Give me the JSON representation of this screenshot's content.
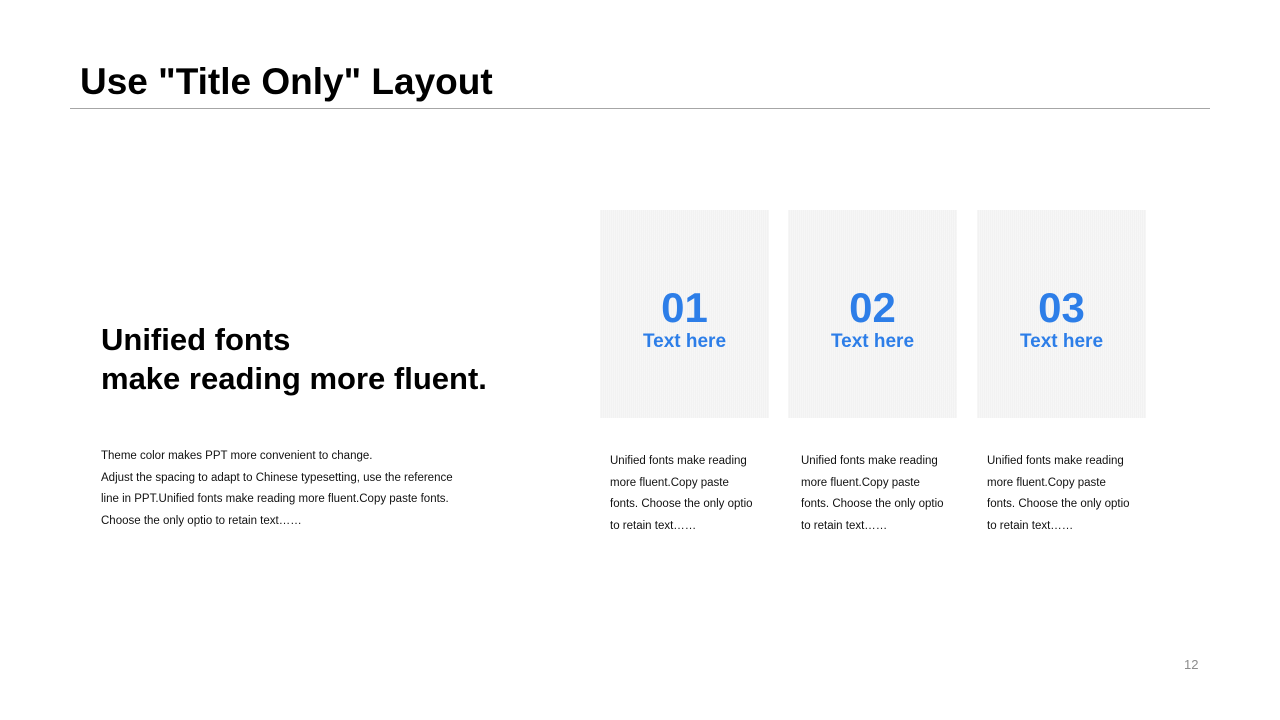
{
  "title": "Use \"Title Only\" Layout",
  "headline": {
    "line1": "Unified fonts",
    "line2": "make reading more fluent."
  },
  "body": {
    "lines": [
      "Theme  color makes PPT more convenient to change.",
      "Adjust the spacing to adapt to Chinese typesetting, use the reference",
      "line in PPT.Unified fonts make reading more fluent.Copy paste fonts.",
      "Choose the only optio to retain text……"
    ]
  },
  "accent_color": "#2d7ee8",
  "cards": [
    {
      "number": "01",
      "label": "Text here",
      "desc": [
        "Unified fonts make reading",
        "more fluent.Copy paste",
        "fonts. Choose the only optio",
        "to retain text……"
      ]
    },
    {
      "number": "02",
      "label": "Text here",
      "desc": [
        "Unified fonts make reading",
        "more fluent.Copy paste",
        "fonts. Choose the only optio",
        "to retain text……"
      ]
    },
    {
      "number": "03",
      "label": "Text here",
      "desc": [
        "Unified fonts make reading",
        "more fluent.Copy paste",
        "fonts. Choose the only optio",
        "to retain text……"
      ]
    }
  ],
  "page_number": "12"
}
